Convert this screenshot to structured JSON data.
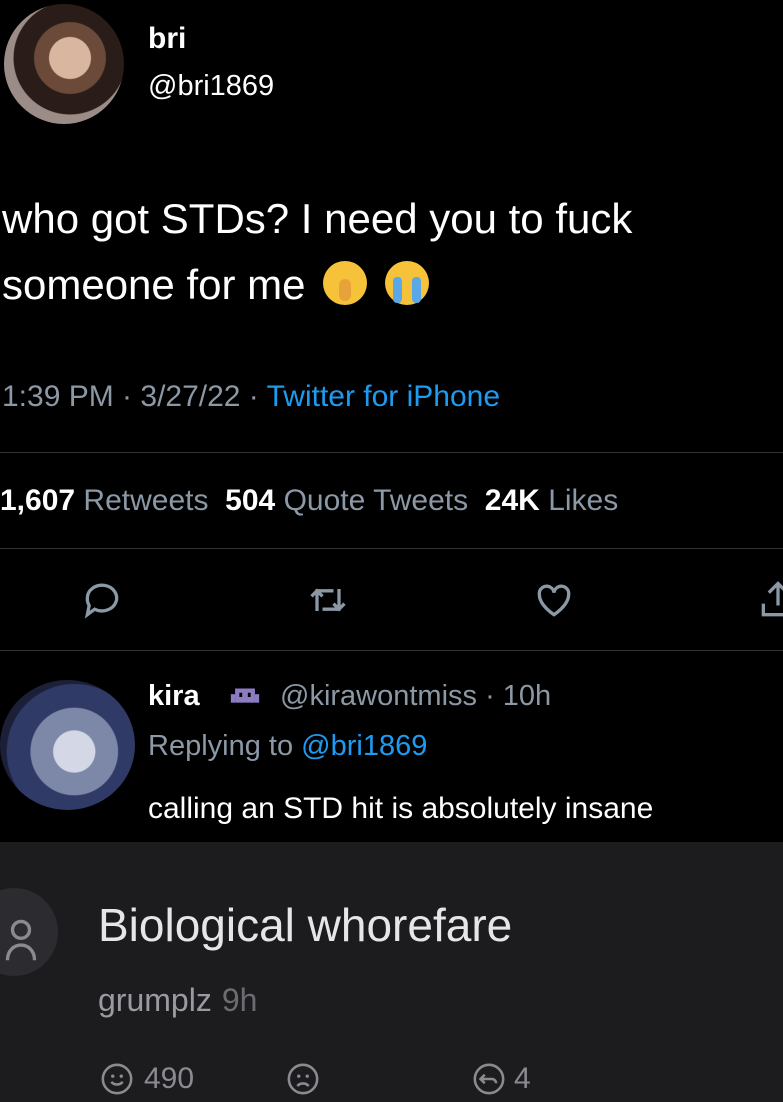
{
  "tweet": {
    "display_name": "bri",
    "handle": "@bri1869",
    "text": "who got STDs? I need you to fuck someone for me",
    "time_date": "1:39 PM · 3/27/22 · ",
    "source": "Twitter for iPhone",
    "retweets_count": "1,607",
    "retweets_label": "Retweets",
    "quotes_count": "504",
    "quotes_label": "Quote Tweets",
    "likes_count": "24K",
    "likes_label": "Likes"
  },
  "reply": {
    "display_name": "kira",
    "handle_time": "@kirawontmiss · 10h",
    "replying_prefix": "Replying to ",
    "replying_handle": "@bri1869",
    "text": "calling an STD hit is absolutely insane"
  },
  "comment": {
    "text": "Biological whorefare",
    "username": "grumplz",
    "time": "9h",
    "upvotes": "490",
    "replies": "4"
  },
  "colors": {
    "background": "#000000",
    "link": "#1d9bf0",
    "muted": "#8b98a5",
    "panel": "#1c1c1f"
  },
  "icons": [
    "reply-icon",
    "retweet-icon",
    "like-icon",
    "share-icon",
    "alien-emoji-icon",
    "smile-icon",
    "frown-icon",
    "comment-reply-icon",
    "user-icon"
  ]
}
